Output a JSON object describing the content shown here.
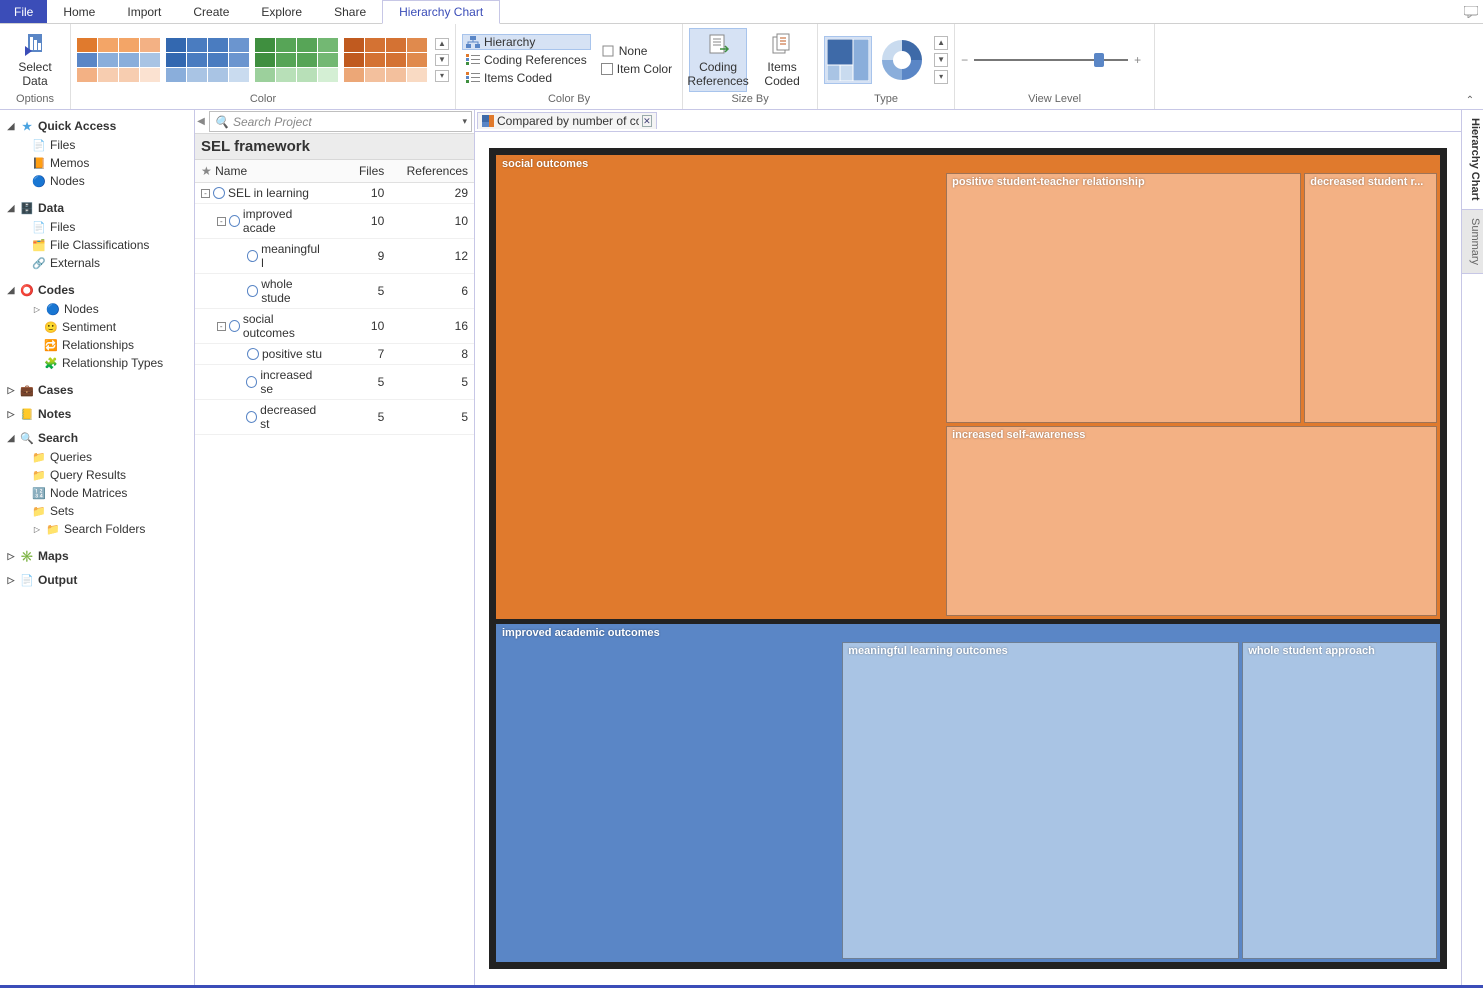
{
  "menu": {
    "file": "File",
    "tabs": [
      "Home",
      "Import",
      "Create",
      "Explore",
      "Share",
      "Hierarchy Chart"
    ],
    "active": "Hierarchy Chart"
  },
  "ribbon": {
    "select_data": "Select Data",
    "options": "Options",
    "group_color": "Color",
    "group_colorby": "Color By",
    "colorby": {
      "hierarchy": "Hierarchy",
      "coding_refs": "Coding References",
      "items_coded": "Items Coded",
      "none": "None",
      "item_color": "Item Color"
    },
    "group_sizeby": "Size By",
    "sizeby": {
      "coding_refs": "Coding References",
      "items_coded": "Items Coded"
    },
    "group_type": "Type",
    "group_viewlevel": "View Level"
  },
  "nav": {
    "quick_access": "Quick Access",
    "qa_items": [
      "Files",
      "Memos",
      "Nodes"
    ],
    "data": "Data",
    "data_items": [
      "Files",
      "File Classifications",
      "Externals"
    ],
    "codes": "Codes",
    "codes_items": [
      "Nodes",
      "Sentiment",
      "Relationships",
      "Relationship Types"
    ],
    "cases": "Cases",
    "notes": "Notes",
    "search": "Search",
    "search_items": [
      "Queries",
      "Query Results",
      "Node Matrices",
      "Sets",
      "Search Folders"
    ],
    "maps": "Maps",
    "output": "Output"
  },
  "list": {
    "search_ph": "Search Project",
    "title": "SEL framework",
    "cols": {
      "name": "Name",
      "files": "Files",
      "refs": "References"
    },
    "rows": [
      {
        "indent": 0,
        "exp": "-",
        "name": "SEL in learning",
        "files": 10,
        "refs": 29
      },
      {
        "indent": 1,
        "exp": "-",
        "name": "improved acade",
        "files": 10,
        "refs": 10
      },
      {
        "indent": 2,
        "exp": "",
        "name": "meaningful l",
        "files": 9,
        "refs": 12
      },
      {
        "indent": 2,
        "exp": "",
        "name": "whole stude",
        "files": 5,
        "refs": 6
      },
      {
        "indent": 1,
        "exp": "-",
        "name": "social outcomes",
        "files": 10,
        "refs": 16
      },
      {
        "indent": 2,
        "exp": "",
        "name": "positive stu",
        "files": 7,
        "refs": 8
      },
      {
        "indent": 2,
        "exp": "",
        "name": "increased se",
        "files": 5,
        "refs": 5
      },
      {
        "indent": 2,
        "exp": "",
        "name": "decreased st",
        "files": 5,
        "refs": 5
      }
    ]
  },
  "detail": {
    "tab_label": "Compared by number of coding r",
    "sidetabs": {
      "chart": "Hierarchy Chart",
      "summary": "Summary"
    }
  },
  "chart_data": {
    "type": "treemap",
    "size_metric": "coding_references",
    "children": [
      {
        "name": "social outcomes",
        "color": "#e07a2d",
        "value": 16,
        "children": [
          {
            "name": "positive student-teacher relationship",
            "value": 8,
            "color": "#f3b184"
          },
          {
            "name": "decreased student r...",
            "value": 5,
            "color": "#f3b184"
          },
          {
            "name": "increased self-awareness",
            "value": 5,
            "color": "#f3b184"
          }
        ]
      },
      {
        "name": "improved academic outcomes",
        "color": "#5a86c6",
        "value": 10,
        "children": [
          {
            "name": "meaningful learning outcomes",
            "value": 12,
            "color": "#a9c4e4"
          },
          {
            "name": "whole student approach",
            "value": 6,
            "color": "#a9c4e4"
          }
        ]
      }
    ]
  },
  "palettes": [
    [
      "#e07a2d",
      "#f3a567",
      "#f3a567",
      "#f3b184",
      "#5a86c6",
      "#8aaedb",
      "#8aaedb",
      "#a9c4e4",
      "#f3b184",
      "#f7cdb0",
      "#f7cdb0",
      "#fbe2d1"
    ],
    [
      "#3368b0",
      "#4a7cc0",
      "#4a7cc0",
      "#6b95cf",
      "#3368b0",
      "#4a7cc0",
      "#4a7cc0",
      "#6b95cf",
      "#8aaedb",
      "#a9c4e4",
      "#a9c4e4",
      "#c9dbef"
    ],
    [
      "#3f8f3f",
      "#57a557",
      "#57a557",
      "#73b873",
      "#3f8f3f",
      "#57a557",
      "#57a557",
      "#73b873",
      "#9cd09c",
      "#b8e0b8",
      "#b8e0b8",
      "#d4efd4"
    ],
    [
      "#c05a1f",
      "#d47233",
      "#d47233",
      "#e08a4d",
      "#c05a1f",
      "#d47233",
      "#d47233",
      "#e08a4d",
      "#eca777",
      "#f3c09d",
      "#f3c09d",
      "#f9dac3"
    ]
  ]
}
